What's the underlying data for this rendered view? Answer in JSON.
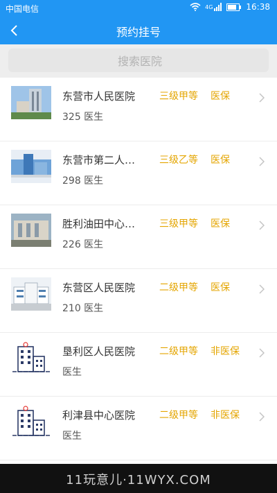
{
  "status_bar": {
    "carrier": "中国电信",
    "network": "4G",
    "time": "16:38"
  },
  "nav": {
    "title": "预约挂号"
  },
  "search": {
    "placeholder": "搜索医院"
  },
  "hospitals": [
    {
      "name": "东营市人民医院",
      "grade": "三级甲等",
      "insurance": "医保",
      "doctors": "325 医生",
      "image": "photo-building-tower"
    },
    {
      "name": "东营市第二人民医院",
      "grade": "三级乙等",
      "insurance": "医保",
      "doctors": "298 医生",
      "image": "photo-building-blue"
    },
    {
      "name": "胜利油田中心医院",
      "grade": "三级甲等",
      "insurance": "医保",
      "doctors": "226 医生",
      "image": "photo-building-gate"
    },
    {
      "name": "东营区人民医院",
      "grade": "二级甲等",
      "insurance": "医保",
      "doctors": "210 医生",
      "image": "photo-building-wide"
    },
    {
      "name": "垦利区人民医院",
      "grade": "二级甲等",
      "insurance": "非医保",
      "doctors": "医生",
      "image": "hospital-outline-icon"
    },
    {
      "name": "利津县中心医院",
      "grade": "二级甲等",
      "insurance": "非医保",
      "doctors": "医生",
      "image": "hospital-outline-icon"
    }
  ],
  "watermark": "11玩意儿·11WYX.COM",
  "colors": {
    "primary": "#2196f3",
    "grade_text": "#e4a500",
    "system_bar": "#111111"
  }
}
